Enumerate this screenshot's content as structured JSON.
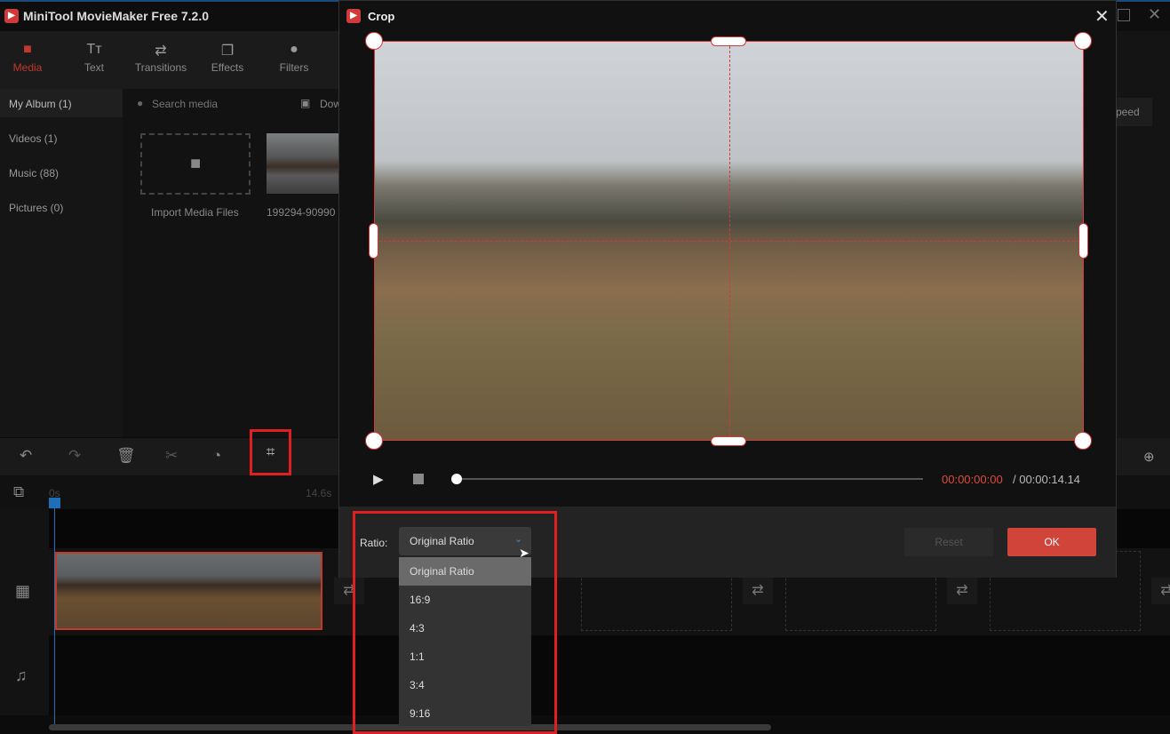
{
  "app": {
    "title": "MiniTool MovieMaker Free 7.2.0",
    "logo": "MiniTool logo"
  },
  "toolbar": [
    {
      "label": "Media",
      "icon": "folder-icon",
      "active": true
    },
    {
      "label": "Text",
      "icon": "text-icon"
    },
    {
      "label": "Transitions",
      "icon": "transitions-icon"
    },
    {
      "label": "Effects",
      "icon": "effects-icon"
    },
    {
      "label": "Filters",
      "icon": "filters-icon"
    }
  ],
  "sidebar": [
    {
      "label": "My Album (1)",
      "active": true
    },
    {
      "label": "Videos (1)"
    },
    {
      "label": "Music (88)"
    },
    {
      "label": "Pictures (0)"
    }
  ],
  "media": {
    "search_placeholder": "Search media",
    "download_label": "Dow",
    "import_label": "Import Media Files",
    "clip_name": "199294-90990"
  },
  "right_panel": {
    "speed_label": "peed"
  },
  "timeline": {
    "start": "0s",
    "end": "14.6s"
  },
  "dialog": {
    "title": "Crop",
    "time_current": "00:00:00:00",
    "time_total": "/ 00:00:14.14",
    "progress": 0,
    "ratio_label": "Ratio:",
    "ratio_value": "Original Ratio",
    "reset_label": "Reset",
    "ok_label": "OK",
    "options": [
      "Original Ratio",
      "16:9",
      "4:3",
      "1:1",
      "3:4",
      "9:16"
    ]
  },
  "colors": {
    "accent": "#d23a3a",
    "playhead": "#1f6fb8"
  }
}
